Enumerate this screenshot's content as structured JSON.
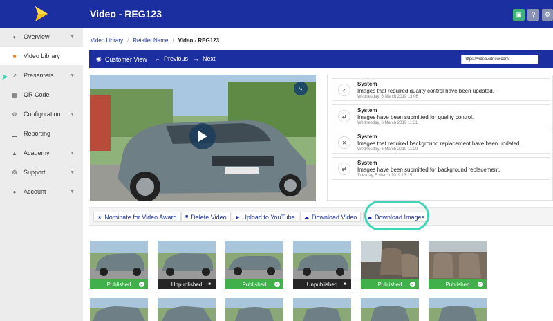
{
  "header": {
    "title": "Video - REG123"
  },
  "colors": {
    "brand": "#1b2fa0",
    "accent": "#f07b1d",
    "published": "#3fb04a",
    "unpublished": "#262626",
    "highlight": "#3dd6b6",
    "top_btn_green": "#3fb07a",
    "top_btn_gray": "#8a92b4"
  },
  "sidebar": {
    "items": [
      {
        "label": "Overview",
        "icon": "dashboard-icon"
      },
      {
        "label": "Video Library",
        "icon": "video-library-icon"
      },
      {
        "label": "Presenters",
        "icon": "chart-line-icon"
      },
      {
        "label": "QR Code",
        "icon": "qr-code-icon"
      },
      {
        "label": "Configuration",
        "icon": "gear-icon"
      },
      {
        "label": "Reporting",
        "icon": "bar-chart-icon"
      },
      {
        "label": "Academy",
        "icon": "graduation-cap-icon"
      },
      {
        "label": "Support",
        "icon": "lifebuoy-icon"
      },
      {
        "label": "Account",
        "icon": "user-icon"
      }
    ]
  },
  "breadcrumb": {
    "items": [
      "Video Library",
      "Retailer Name"
    ],
    "current": "Video - REG123"
  },
  "actionbar": {
    "customer_view": "Customer View",
    "previous": "Previous",
    "next": "Next",
    "url": "https://video.citnow.com/"
  },
  "activity": [
    {
      "title": "System",
      "message": "Images that required quality control have been updated.",
      "time": "Wednesday, 6 March 2019 13:06",
      "icon": "check-icon"
    },
    {
      "title": "System",
      "message": "Images have been submitted for quality control.",
      "time": "Wednesday, 6 March 2019 11:31",
      "icon": "transfer-icon"
    },
    {
      "title": "System",
      "message": "Images that required background replacement have been updated.",
      "time": "Wednesday, 6 March 2019 11:29",
      "icon": "shuffle-icon"
    },
    {
      "title": "System",
      "message": "Images have been submitted for background replacement.",
      "time": "Tuesday, 5 March 2019 13:15",
      "icon": "transfer-icon"
    }
  ],
  "toolbar": {
    "nominate": "Nominate for Video Award",
    "delete": "Delete Video",
    "youtube": "Upload to YouTube",
    "download_video": "Download Video",
    "download_images": "Download Images"
  },
  "thumbnails": [
    {
      "status": "Published"
    },
    {
      "status": "Unpublished"
    },
    {
      "status": "Published"
    },
    {
      "status": "Unpublished"
    },
    {
      "status": "Published"
    },
    {
      "status": "Published"
    }
  ]
}
